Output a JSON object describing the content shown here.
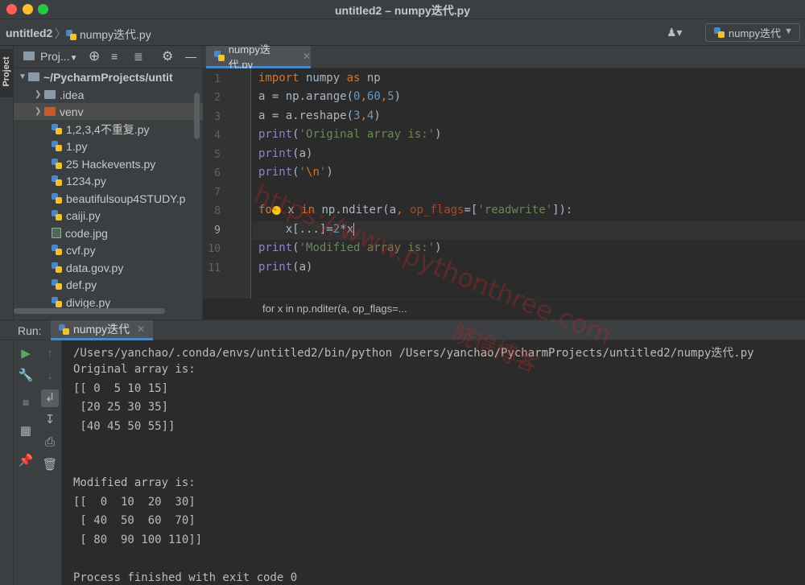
{
  "window": {
    "title": "untitled2 – numpy迭代.py"
  },
  "navbar": {
    "project": "untitled2",
    "file": "numpy迭代.py",
    "run_config": "numpy迭代"
  },
  "left_strip": {
    "project_tab": "Project"
  },
  "project_panel": {
    "title": "Proj...",
    "root": "~/PycharmProjects/untit",
    "items": [
      {
        "label": ".idea",
        "type": "folder",
        "color": "#8a9aa8"
      },
      {
        "label": "venv",
        "type": "folder",
        "color": "#c75a2c"
      },
      {
        "label": "1,2,3,4不重复.py",
        "type": "py"
      },
      {
        "label": "1.py",
        "type": "py"
      },
      {
        "label": "25 Hackevents.py",
        "type": "py"
      },
      {
        "label": "1234.py",
        "type": "py"
      },
      {
        "label": "beautifulsoup4STUDY.p",
        "type": "py"
      },
      {
        "label": "caiji.py",
        "type": "py"
      },
      {
        "label": "code.jpg",
        "type": "image"
      },
      {
        "label": "cvf.py",
        "type": "py"
      },
      {
        "label": "data.gov.py",
        "type": "py"
      },
      {
        "label": "def.py",
        "type": "py"
      },
      {
        "label": "divige.py",
        "type": "py"
      }
    ]
  },
  "editor": {
    "tab": "numpy迭代.py",
    "line_numbers": [
      "1",
      "2",
      "3",
      "4",
      "5",
      "6",
      "7",
      "8",
      "9",
      "10",
      "11"
    ],
    "breadcrumb": "for x in np.nditer(a, op_flags=..."
  },
  "run": {
    "label": "Run:",
    "tab": "numpy迭代",
    "output": [
      "/Users/yanchao/.conda/envs/untitled2/bin/python /Users/yanchao/PycharmProjects/untitled2/numpy迭代.py",
      "Original array is:",
      "[[ 0  5 10 15]",
      " [20 25 30 35]",
      " [40 45 50 55]]",
      "",
      "",
      "Modified array is:",
      "[[  0  10  20  30]",
      " [ 40  50  60  70]",
      " [ 80  90 100 110]]",
      "",
      "Process finished with exit code 0"
    ]
  },
  "watermark": {
    "url": "https://www.pythonthree.com",
    "name": "晓得博客"
  },
  "colors": {
    "keyword": "#cc7832",
    "number": "#6897bb",
    "string": "#6a8759",
    "builtin": "#8888c6",
    "accent": "#4a88c7"
  }
}
